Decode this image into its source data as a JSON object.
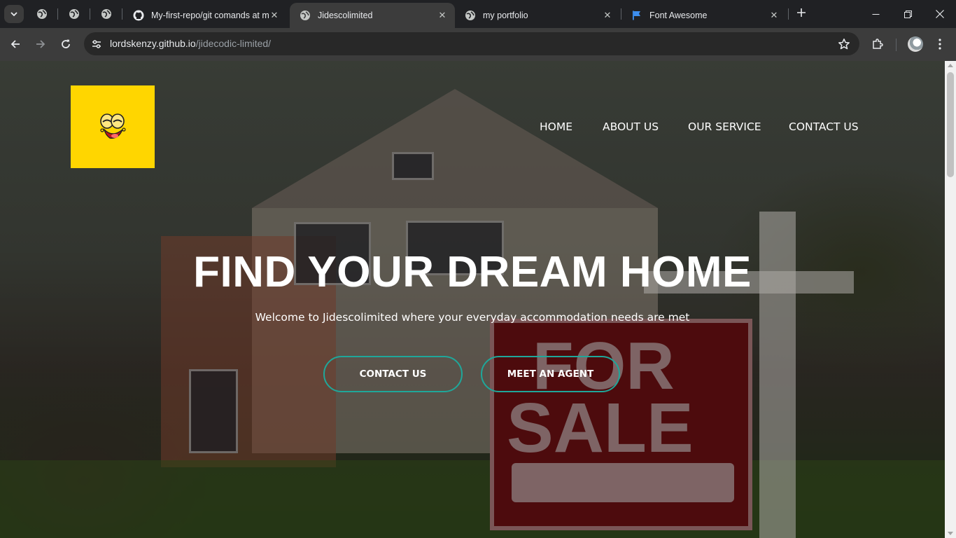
{
  "browser": {
    "tabs": [
      {
        "title": "My-first-repo/git comands at m",
        "icon": "github-icon"
      },
      {
        "title": "Jidescolimited",
        "icon": "globe-icon",
        "active": true
      },
      {
        "title": "my portfolio",
        "icon": "globe-icon"
      },
      {
        "title": "Font Awesome",
        "icon": "flag-icon"
      }
    ],
    "url_host": "lordskenzy.github.io",
    "url_path": "/jidecodic-limited/"
  },
  "page": {
    "nav": [
      "HOME",
      "ABOUT US",
      "OUR SERVICE",
      "CONTACT US"
    ],
    "headline": "FIND YOUR DREAM HOME",
    "subline": "Welcome to Jidescolimited where your everyday accommodation needs are met",
    "buttons": {
      "contact": "CONTACT US",
      "agent": "MEET AN AGENT"
    },
    "background_sign": {
      "line1": "FOR",
      "line2": "SALE"
    },
    "accent_color": "#1fa79a",
    "logo_color": "#ffd600"
  }
}
